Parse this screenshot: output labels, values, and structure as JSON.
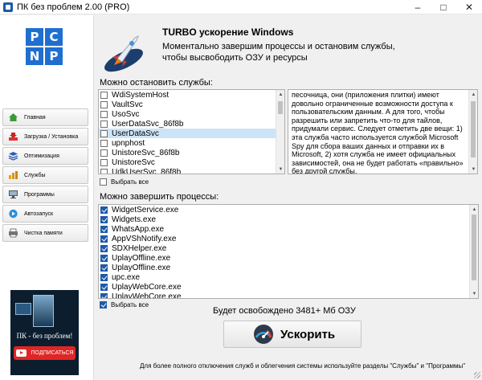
{
  "window": {
    "title": "ПК без проблем 2.00 (PRO)"
  },
  "logo": {
    "letters": [
      "P",
      "C",
      "N",
      "P"
    ]
  },
  "sidebar": {
    "items": [
      {
        "label": "Главная",
        "icon": "home-icon"
      },
      {
        "label": "Загрузка / Установка",
        "icon": "download-icon"
      },
      {
        "label": "Оптимизация",
        "icon": "layers-icon"
      },
      {
        "label": "Службы",
        "icon": "bars-icon"
      },
      {
        "label": "Программы",
        "icon": "monitor-icon"
      },
      {
        "label": "Автозапуск",
        "icon": "play-icon"
      },
      {
        "label": "Чистка памяти",
        "icon": "printer-icon"
      }
    ]
  },
  "promo": {
    "caption": "ПК - без проблем!",
    "subscribe": "ПОДПИСАТЬСЯ"
  },
  "header": {
    "title": "TURBO ускорение Windows",
    "description": "Моментально завершим процессы и остановим службы, чтобы высвободить ОЗУ и ресурсы"
  },
  "services": {
    "label": "Можно остановить службы:",
    "items": [
      {
        "name": "WdiSystemHost",
        "checked": false
      },
      {
        "name": "VaultSvc",
        "checked": false
      },
      {
        "name": "UsoSvc",
        "checked": false
      },
      {
        "name": "UserDataSvc_86f8b",
        "checked": false
      },
      {
        "name": "UserDataSvc",
        "checked": false,
        "selected": true
      },
      {
        "name": "upnphost",
        "checked": false
      },
      {
        "name": "UnistoreSvc_86f8b",
        "checked": false
      },
      {
        "name": "UnistoreSvc",
        "checked": false
      },
      {
        "name": "UdkUserSvc_86f8b",
        "checked": false
      },
      {
        "name": "UdkUserSvc",
        "checked": false
      }
    ],
    "select_all": "Выбрать все",
    "select_all_checked": false
  },
  "service_description": "песочница, они (приложения плитки) имеют довольно ограниченные возможности доступа к пользовательским данным. А для того, чтобы разрешить или запретить что-то для тайлов, придумали сервис. Следует отметить две вещи: 1) эта служба часто используется службой Microsoft Spy для сбора ваших данных и отправки их в Microsoft, 2) хотя служба не имеет официальных зависимостей, она не будет работать «правильно» без другой службы.",
  "processes": {
    "label": "Можно завершить процессы:",
    "items": [
      {
        "name": "WidgetService.exe",
        "checked": true
      },
      {
        "name": "Widgets.exe",
        "checked": true
      },
      {
        "name": "WhatsApp.exe",
        "checked": true
      },
      {
        "name": "AppVShNotify.exe",
        "checked": true
      },
      {
        "name": "SDXHelper.exe",
        "checked": true
      },
      {
        "name": "UplayOffline.exe",
        "checked": true
      },
      {
        "name": "UplayOffline.exe",
        "checked": true
      },
      {
        "name": "upc.exe",
        "checked": true
      },
      {
        "name": "UplayWebCore.exe",
        "checked": true
      },
      {
        "name": "UplayWebCore.exe",
        "checked": true
      },
      {
        "name": "UplayWebCore.exe",
        "checked": true
      }
    ],
    "select_all": "Выбрать все",
    "select_all_checked": true
  },
  "summary": {
    "freed_text": "Будет освобождено 3481+ Мб ОЗУ"
  },
  "accelerate": {
    "label": "Ускорить"
  },
  "footer": {
    "text": "Для более полного отключения служб и облегчения системы используйте разделы \"Службы\" и \"Программы\""
  },
  "colors": {
    "accent": "#1f6fd1",
    "check": "#1e5aa8",
    "selection": "#cce4f7",
    "subscribe": "#e02525"
  }
}
